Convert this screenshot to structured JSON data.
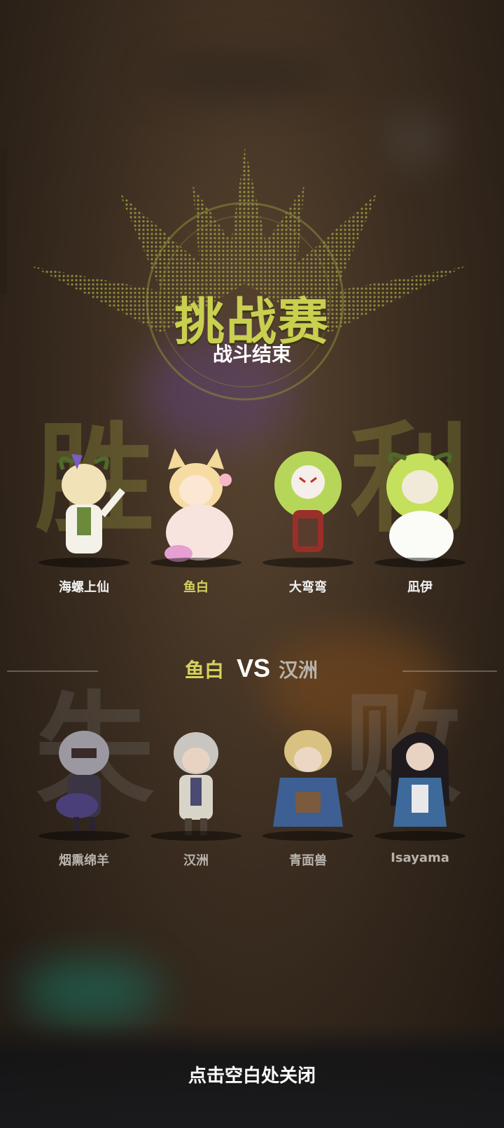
{
  "mode_title": "挑战赛",
  "mode_subtitle": "战斗结束",
  "result_win_chars": [
    "胜",
    "利"
  ],
  "result_lose_chars": [
    "失",
    "败"
  ],
  "winners": [
    {
      "name": "海螺上仙",
      "highlight": false
    },
    {
      "name": "鱼白",
      "highlight": true
    },
    {
      "name": "大弯弯",
      "highlight": false
    },
    {
      "name": "凪伊",
      "highlight": false
    }
  ],
  "matchup": {
    "left": "鱼白",
    "vs": "VS",
    "right": "汉洲"
  },
  "losers": [
    {
      "name": "烟熏绵羊"
    },
    {
      "name": "汉洲"
    },
    {
      "name": "青面兽"
    },
    {
      "name": "Isayama"
    }
  ],
  "close_hint": "点击空白处关闭",
  "colors": {
    "accent": "#c9cf4f",
    "highlight_name": "#d6d25a",
    "loser_name": "#b7b2ab"
  }
}
